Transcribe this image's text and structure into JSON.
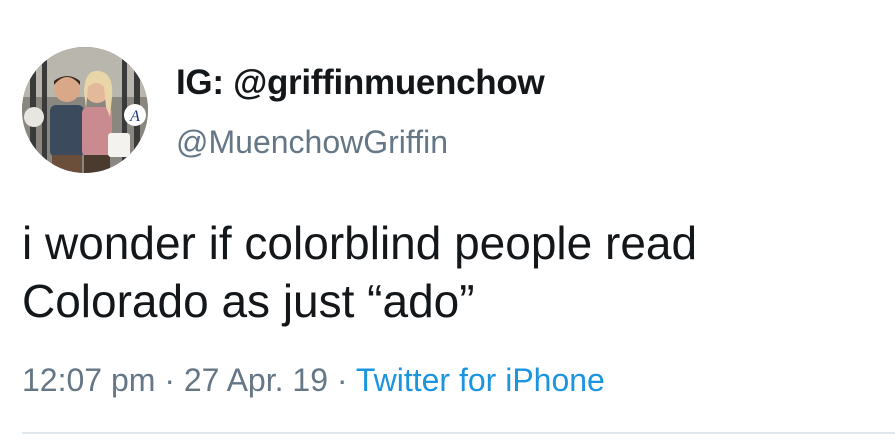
{
  "tweet": {
    "display_name": "IG: @griffinmuenchow",
    "handle": "@MuenchowGriffin",
    "text_line_1": "i wonder if colorblind people read",
    "text_line_2": "Colorado as just “ado”",
    "time": "12:07 pm",
    "separator": "·",
    "date": "27 Apr. 19",
    "source": "Twitter for iPhone"
  },
  "colors": {
    "text_primary": "#14171a",
    "text_secondary": "#657786",
    "link": "#1b95e0"
  }
}
